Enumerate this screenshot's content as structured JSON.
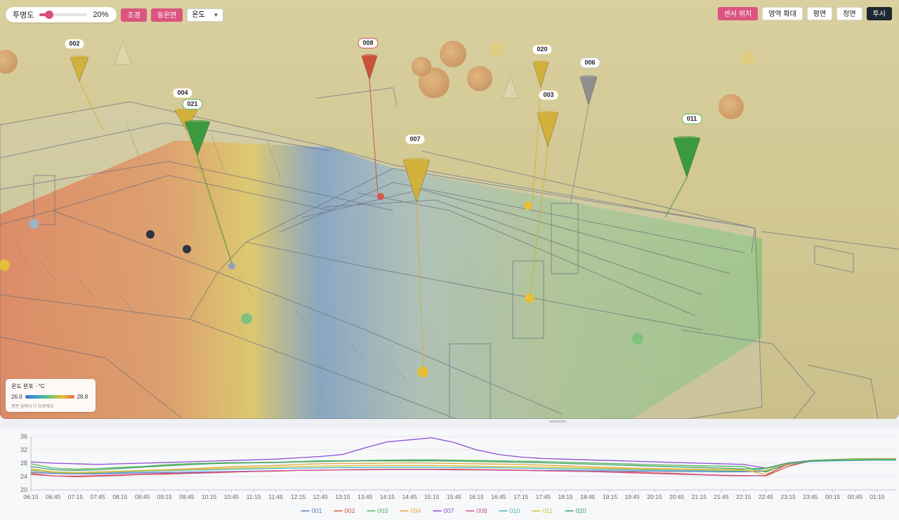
{
  "toolbar": {
    "opacity_label": "투명도",
    "opacity_value": 0.2,
    "opacity_text": "20%",
    "landscape_button": "조경",
    "contour_button": "등온면",
    "metric_select": "온도",
    "sensor_location_button": "센서 위치",
    "zoom_area_button": "영역 확대",
    "plan_button": "평면",
    "front_button": "정면",
    "perspective_button": "투시"
  },
  "sensors": [
    {
      "id": "002",
      "color": "#d1b03c",
      "ring": "yellow"
    },
    {
      "id": "008",
      "color": "#c9523c",
      "ring": "red"
    },
    {
      "id": "020",
      "color": "#d1b03c",
      "ring": "yellow"
    },
    {
      "id": "006",
      "color": "#8e8e8e",
      "ring": "grey"
    },
    {
      "id": "004",
      "color": "#d1b03c",
      "ring": "yellow"
    },
    {
      "id": "021",
      "color": "#3c9a3e",
      "ring": "green"
    },
    {
      "id": "003",
      "color": "#d1b03c",
      "ring": "yellow"
    },
    {
      "id": "007",
      "color": "#d1b03c",
      "ring": "yellow"
    },
    {
      "id": "011",
      "color": "#3c9a3e",
      "ring": "green"
    }
  ],
  "legend": {
    "title": "온도 분포 · °C",
    "min": "26.0",
    "max": "28.8",
    "hint": "평면 뷰에서 더 또렷해요"
  },
  "chart_data": {
    "type": "line",
    "x_ticks": [
      "06:15",
      "06:45",
      "07:15",
      "07:45",
      "08:15",
      "08:45",
      "09:15",
      "09:45",
      "10:15",
      "10:45",
      "11:15",
      "11:45",
      "12:15",
      "12:45",
      "13:15",
      "13:45",
      "14:15",
      "14:45",
      "15:15",
      "15:45",
      "16:15",
      "16:45",
      "17:15",
      "17:45",
      "18:15",
      "18:45",
      "19:15",
      "19:45",
      "20:15",
      "20:45",
      "21:15",
      "21:45",
      "22:15",
      "22:45",
      "23:15",
      "23:45",
      "00:15",
      "00:45",
      "01:15"
    ],
    "ylim": [
      20,
      36
    ],
    "y_ticks": [
      20,
      24,
      28,
      32,
      36
    ],
    "grid": true,
    "legend_position": "bottom",
    "series": [
      {
        "name": "001",
        "color": "#5b7fc7",
        "values": [
          25.3,
          24.9,
          24.8,
          24.8,
          25.0,
          25.1,
          25.2,
          25.3,
          25.4,
          25.5,
          25.6,
          25.7,
          25.8,
          25.9,
          26.0,
          26.0,
          26.1,
          26.1,
          26.1,
          26.0,
          26.0,
          25.9,
          25.9,
          25.8,
          25.8,
          25.7,
          25.7,
          25.6,
          25.6,
          25.5,
          25.5,
          25.4,
          25.4,
          25.6,
          27.5,
          28.5,
          28.8,
          28.9,
          29.0
        ]
      },
      {
        "name": "002",
        "color": "#d65c3c",
        "values": [
          25.0,
          24.2,
          23.9,
          24.1,
          24.3,
          24.6,
          24.7,
          24.9,
          25.1,
          25.3,
          25.5,
          25.6,
          25.8,
          25.9,
          26.0,
          26.1,
          26.2,
          26.2,
          26.2,
          26.2,
          26.1,
          26.0,
          25.9,
          25.7,
          25.6,
          25.5,
          25.4,
          25.3,
          25.1,
          24.9,
          24.6,
          24.4,
          24.3,
          24.2,
          27.0,
          28.7,
          29.0,
          29.2,
          29.3
        ]
      },
      {
        "name": "003",
        "color": "#55b45a",
        "values": [
          27.8,
          26.5,
          26.2,
          26.4,
          26.7,
          27.0,
          27.5,
          27.8,
          28.0,
          28.2,
          28.2,
          28.3,
          28.5,
          28.7,
          28.7,
          28.8,
          28.9,
          29.0,
          29.0,
          28.9,
          28.8,
          28.7,
          28.6,
          28.5,
          28.3,
          28.1,
          27.9,
          27.7,
          27.5,
          27.4,
          27.2,
          27.1,
          27.0,
          25.3,
          28.0,
          28.8,
          29.1,
          29.3,
          29.4
        ]
      },
      {
        "name": "004",
        "color": "#e6a93a",
        "values": [
          26.3,
          25.4,
          25.2,
          25.4,
          25.6,
          25.8,
          26.0,
          26.3,
          26.6,
          26.9,
          27.1,
          27.3,
          27.6,
          27.8,
          27.9,
          27.9,
          28.0,
          28.1,
          28.0,
          27.9,
          27.8,
          27.7,
          27.6,
          27.4,
          27.2,
          26.9,
          26.7,
          26.5,
          26.4,
          26.3,
          26.2,
          26.1,
          26.0,
          24.6,
          27.6,
          28.7,
          29.0,
          29.2,
          29.3
        ]
      },
      {
        "name": "007",
        "color": "#8b4fd0",
        "values": [
          28.4,
          28.0,
          27.8,
          27.6,
          27.8,
          28.0,
          28.2,
          28.4,
          28.6,
          28.8,
          29.0,
          29.2,
          29.6,
          30.0,
          30.6,
          32.6,
          34.4,
          35.0,
          35.6,
          34.2,
          32.0,
          30.6,
          29.8,
          29.4,
          29.2,
          29.0,
          28.8,
          28.6,
          28.4,
          28.2,
          28.0,
          27.8,
          27.6,
          26.5,
          28.1,
          28.8,
          29.0,
          29.2,
          29.3
        ]
      },
      {
        "name": "008",
        "color": "#d4528f",
        "values": [
          24.6,
          24.2,
          24.1,
          24.3,
          24.5,
          24.7,
          24.9,
          25.0,
          25.2,
          25.4,
          25.5,
          25.7,
          25.8,
          25.9,
          26.0,
          26.0,
          26.1,
          26.1,
          26.1,
          26.0,
          26.0,
          25.9,
          25.8,
          25.7,
          25.6,
          25.5,
          25.3,
          25.1,
          24.9,
          24.7,
          24.5,
          24.3,
          24.2,
          24.3,
          27.8,
          28.8,
          29.0,
          29.2,
          29.3
        ]
      },
      {
        "name": "010",
        "color": "#4bb8c2",
        "values": [
          25.8,
          25.2,
          25.0,
          25.1,
          25.3,
          25.5,
          25.7,
          25.9,
          26.0,
          26.2,
          26.3,
          26.4,
          26.5,
          26.6,
          26.7,
          26.7,
          26.8,
          26.8,
          26.8,
          26.7,
          26.7,
          26.6,
          26.5,
          26.4,
          26.3,
          26.2,
          26.1,
          26.0,
          25.9,
          25.8,
          25.7,
          25.6,
          25.6,
          26.4,
          27.8,
          28.5,
          28.7,
          28.8,
          28.9
        ]
      },
      {
        "name": "011",
        "color": "#d6c23a",
        "values": [
          26.0,
          25.3,
          25.1,
          25.2,
          25.5,
          25.7,
          25.9,
          26.1,
          26.3,
          26.5,
          26.6,
          26.8,
          27.0,
          27.1,
          27.2,
          27.3,
          27.3,
          27.3,
          27.3,
          27.2,
          27.1,
          27.0,
          26.9,
          26.8,
          26.7,
          26.5,
          26.4,
          26.3,
          26.2,
          26.1,
          26.0,
          25.9,
          25.8,
          25.8,
          27.9,
          28.8,
          29.0,
          29.2,
          29.3
        ]
      },
      {
        "name": "020",
        "color": "#3ea66a",
        "values": [
          27.0,
          26.0,
          25.8,
          26.0,
          26.4,
          26.8,
          27.2,
          27.5,
          27.8,
          28.0,
          28.1,
          28.2,
          28.4,
          28.5,
          28.6,
          28.7,
          28.7,
          28.7,
          28.7,
          28.6,
          28.5,
          28.4,
          28.3,
          28.1,
          27.9,
          27.7,
          27.5,
          27.3,
          27.1,
          26.9,
          26.7,
          26.5,
          26.3,
          26.5,
          28.0,
          28.7,
          28.9,
          29.0,
          29.1
        ]
      }
    ]
  }
}
